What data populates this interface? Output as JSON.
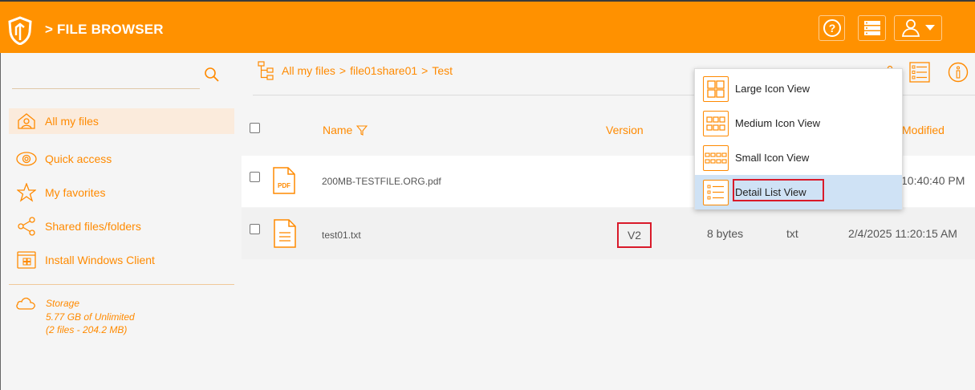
{
  "header": {
    "title": "> FILE BROWSER",
    "help_icon": "help-circle-icon",
    "storage_icon": "server-stack-icon",
    "user_icon": "user-account-icon"
  },
  "sidebar": {
    "search_placeholder": "",
    "items": [
      {
        "label": "All my files",
        "icon": "home-user-icon",
        "active": true
      },
      {
        "label": "Quick access",
        "icon": "eye-icon"
      },
      {
        "label": "My favorites",
        "icon": "star-icon"
      },
      {
        "label": "Shared files/folders",
        "icon": "share-icon"
      },
      {
        "label": "Install Windows Client",
        "icon": "windows-client-icon"
      }
    ],
    "storage": {
      "title": "Storage",
      "usage": "5.77 GB of Unlimited",
      "files": "(2 files - 204.2 MB)"
    }
  },
  "breadcrumb": {
    "root": "All my files",
    "sep1": ">",
    "share": "file01share01",
    "sep2": ">",
    "current": "Test"
  },
  "table": {
    "columns": {
      "name": "Name",
      "version": "Version",
      "modified": "Modified"
    },
    "rows": [
      {
        "name": "200MB-TESTFILE.ORG.pdf",
        "icon_label": "PDF",
        "version": "",
        "size": "",
        "type": "",
        "modified": "10:40:40 PM"
      },
      {
        "name": "test01.txt",
        "version": "V2",
        "size": "8 bytes",
        "type": "txt",
        "modified": "2/4/2025 11:20:15 AM"
      }
    ]
  },
  "view_menu": {
    "items": [
      {
        "label": "Large Icon View"
      },
      {
        "label": "Medium Icon View"
      },
      {
        "label": "Small Icon View"
      },
      {
        "label": "Detail List View",
        "selected": true
      }
    ]
  },
  "colors": {
    "accent": "#ff9100",
    "highlight": "#d91a2a",
    "selected_bg": "#cfe2f5"
  }
}
